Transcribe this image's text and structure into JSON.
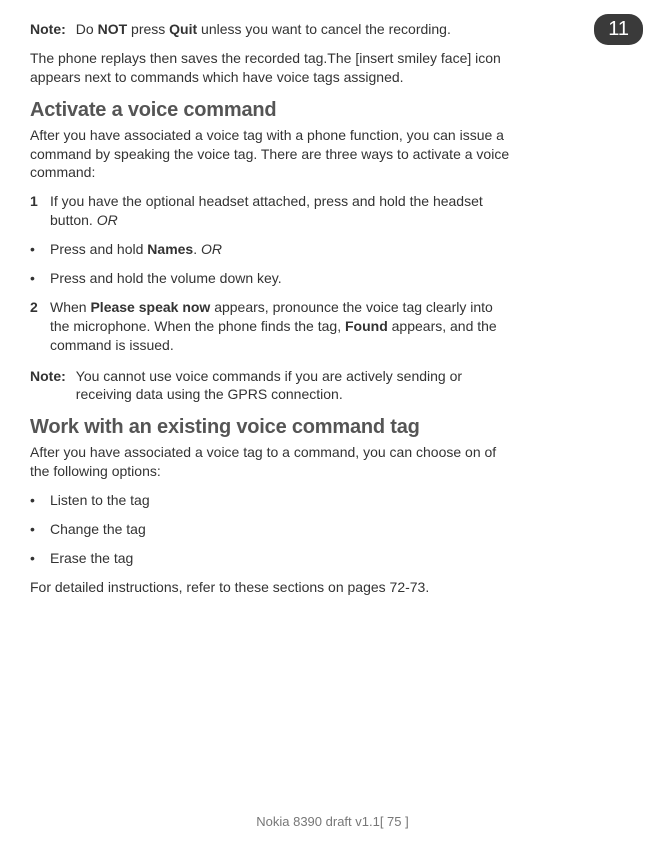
{
  "chapter_number": "11",
  "note1": {
    "label": "Note:",
    "pre": "Do ",
    "strong1": "NOT",
    "mid": " press ",
    "strong2": "Quit",
    "post": " unless you want to cancel the recording."
  },
  "para1": "The phone replays then saves the recorded tag.The [insert smiley face] icon appears next to commands which have voice tags assigned.",
  "heading1": "Activate a voice command",
  "para2": "After you have associated a voice tag with a phone function, you can issue a command by speaking the voice tag. There are three ways to activate a voice command:",
  "step1": {
    "num": "1",
    "text": "If you have the optional headset attached, press and hold the headset button. ",
    "or": "OR"
  },
  "bullet1": {
    "pre": "Press and hold ",
    "bold": "Names",
    "post": ". ",
    "or": "OR"
  },
  "bullet2": "Press and hold the volume down key.",
  "step2": {
    "num": "2",
    "pre": "When ",
    "bold1": "Please speak now",
    "mid": " appears, pronounce the voice tag clearly into the microphone. When the phone finds the tag, ",
    "bold2": "Found",
    "post": " appears, and the command is issued."
  },
  "note2": {
    "label": "Note:",
    "text": "You cannot use voice commands if you are actively sending or receiving data using the GPRS connection."
  },
  "heading2": "Work with an existing voice command tag",
  "para3": "After you have associated a voice tag to a command, you can choose on of the following options:",
  "opt1": "Listen to the tag",
  "opt2": "Change the tag",
  "opt3": "Erase the tag",
  "para4": "For detailed instructions, refer to these sections on pages 72-73.",
  "footer": "Nokia 8390 draft v1.1[ 75 ]"
}
